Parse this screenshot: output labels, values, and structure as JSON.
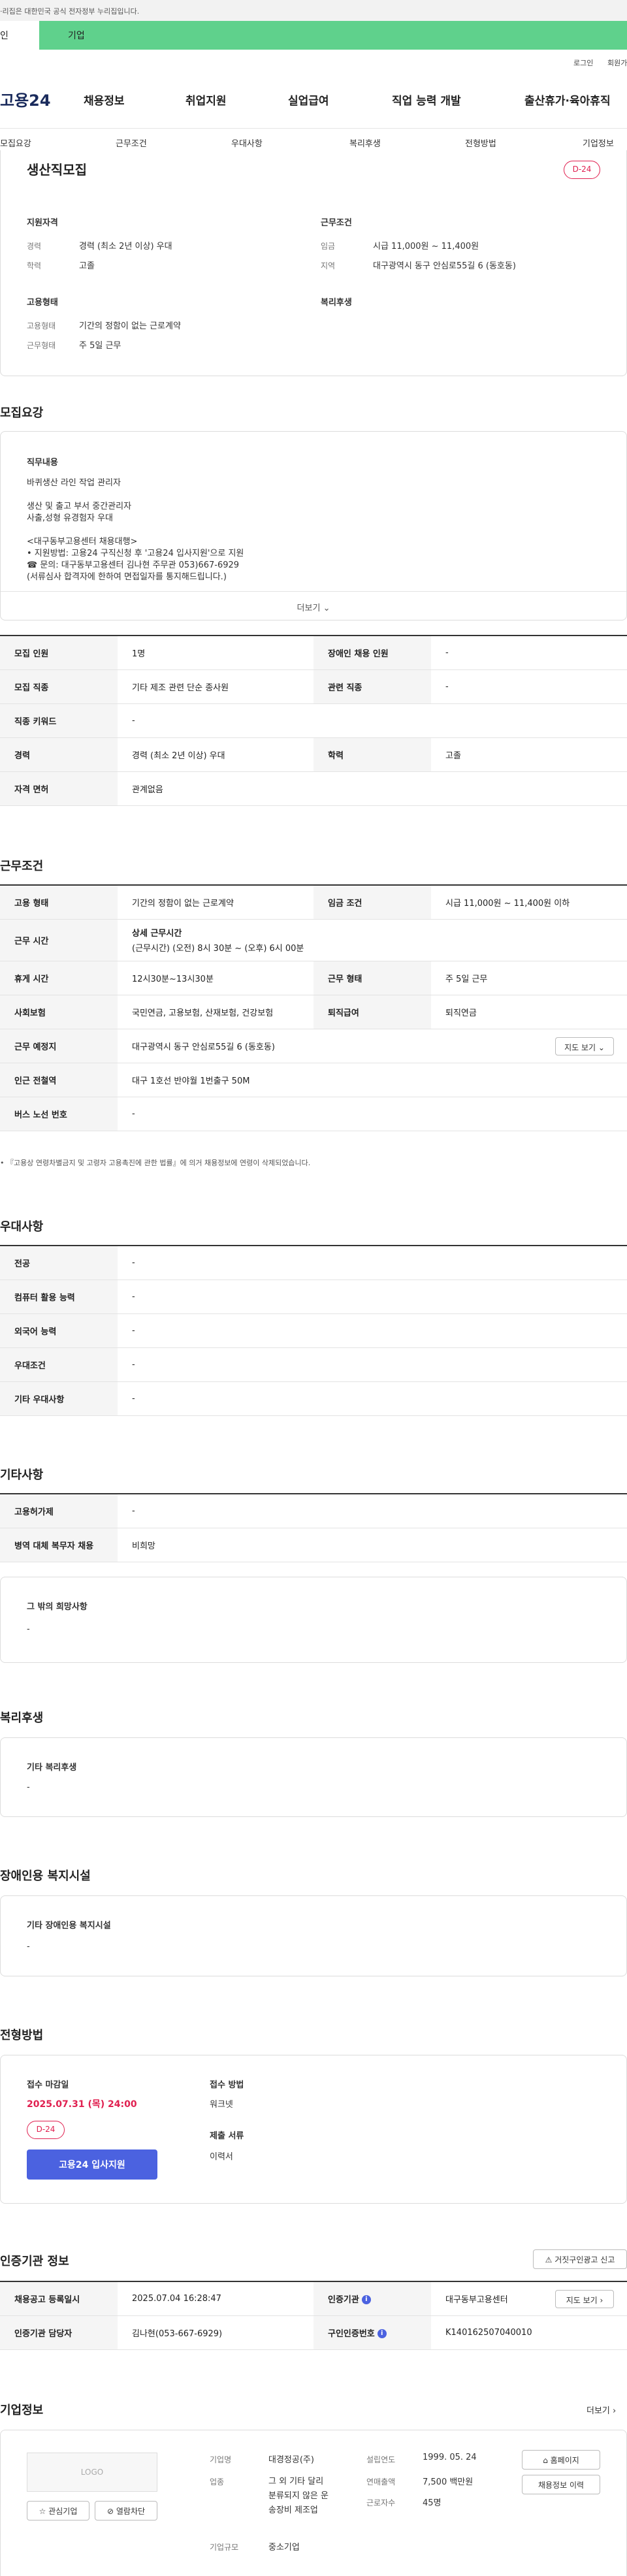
{
  "gov_banner": {
    "text": "·리집은 대한민국 공식 전자정부 누리집입니다."
  },
  "audience_tabs": {
    "individual": "인",
    "company": "기업"
  },
  "util": {
    "login": "로그인",
    "signup": "회원가"
  },
  "gnb": {
    "logo": "고용24",
    "menu": [
      "채용정보",
      "취업지원",
      "실업급여",
      "직업 능력 개발",
      "출산휴가·육아휴직"
    ]
  },
  "subnav": [
    "모집요강",
    "근무조건",
    "우대사항",
    "복리후생",
    "전형방법",
    "기업정보"
  ],
  "summary": {
    "title": "생산직모집",
    "dday": "D-24",
    "req_title": "지원자격",
    "career_label": "경력",
    "career_value": "경력 (최소 2년 이상) 우대",
    "edu_label": "학력",
    "edu_value": "고졸",
    "work_title": "근무조건",
    "wage_label": "임금",
    "wage_value": "시급 11,000원 ~ 11,400원",
    "region_label": "지역",
    "region_value": "대구광역시 동구 안심로55길 6 (동호동)",
    "emp_title": "고용형태",
    "emp_type_label": "고용형태",
    "emp_type_value": "기간의 정함이 없는 근로계약",
    "workdays_label": "근무형태",
    "workdays_value": "주 5일 근무",
    "welfare_title": "복리후생"
  },
  "recruit": {
    "section_title": "모집요강",
    "duty_title": "직무내용",
    "duty_lines": [
      "바퀴생산 라인 작업 관리자",
      "",
      "생산 및 출고  부서  중간관리자",
      "사출,성형 유경험자 우대",
      "",
      "<대구동부고용센터 채용대행>",
      "• 지원방법: 고용24 구직신청 후 '고용24 입사지원'으로 지원",
      "☎ 문의: 대구동부고용센터 김나현 주무관 053)667-6929",
      "(서류심사 합격자에 한하여 면접일자를 통지해드립니다.)"
    ],
    "more": "더보기",
    "rows": [
      {
        "l1": "모집 인원",
        "v1": "1명",
        "l2": "장애인 채용 인원",
        "v2": "-"
      },
      {
        "l1": "모집 직종",
        "v1": "기타 제조 관련 단순 종사원",
        "l2": "관련 직종",
        "v2": "-"
      },
      {
        "l1": "직종 키워드",
        "v1": "-"
      },
      {
        "l1": "경력",
        "v1": "경력 (최소 2년 이상) 우대",
        "l2": "학력",
        "v2": "고졸"
      },
      {
        "l1": "자격 면허",
        "v1": "관계없음"
      }
    ]
  },
  "work": {
    "section_title": "근무조건",
    "emp_type_l": "고용 형태",
    "emp_type_v": "기간의 정함이 없는 근로계약",
    "wage_l": "임금 조건",
    "wage_v": "시급 11,000원 ~ 11,400원 이하",
    "hours_l": "근무 시간",
    "hours_head": "상세 근무시간",
    "hours_v": "(근무시간) (오전) 8시 30분 ~ (오후) 6시 00분",
    "break_l": "휴게 시간",
    "break_v": "12시30분~13시30분",
    "shift_l": "근무 형태",
    "shift_v": "주 5일 근무",
    "insurance_l": "사회보험",
    "insurance_v": "국민연금, 고용보험, 산재보험, 건강보험",
    "retire_l": "퇴직급여",
    "retire_v": "퇴직연금",
    "place_l": "근무 예정지",
    "place_v": "대구광역시 동구 안심로55길 6 (동호동)",
    "map_btn": "지도 보기",
    "station_l": "인근 전철역",
    "station_v": "대구 1호선 반야월 1번출구 50M",
    "bus_l": "버스 노선 번호",
    "bus_v": "-",
    "note": "• 『고용상 연령차별금지 및 고령자 고용촉진에 관한 법률』에 의거 채용정보에 연령이 삭제되었습니다."
  },
  "pref": {
    "section_title": "우대사항",
    "rows": [
      {
        "l": "전공",
        "v": "-"
      },
      {
        "l": "컴퓨터 활용 능력",
        "v": "-"
      },
      {
        "l": "외국어 능력",
        "v": "-"
      },
      {
        "l": "우대조건",
        "v": "-"
      },
      {
        "l": "기타 우대사항",
        "v": "-"
      }
    ]
  },
  "etc": {
    "section_title": "기타사항",
    "rows": [
      {
        "l": "고용허가제",
        "v": "-"
      },
      {
        "l": "병역 대체 복무자 채용",
        "v": "비희망"
      }
    ],
    "hope_title": "그 밖의 희망사항",
    "hope_v": "-"
  },
  "welfare": {
    "section_title": "복리후생",
    "box_title": "기타 복리후생",
    "box_v": "-"
  },
  "disability": {
    "section_title": "장애인용 복지시설",
    "box_title": "기타 장애인용 복지시설",
    "box_v": "-"
  },
  "selection": {
    "section_title": "전형방법",
    "deadline_l": "접수 마감일",
    "deadline_v": "2025.07.31 (목) 24:00",
    "dday": "D-24",
    "apply_btn": "고용24 입사지원",
    "method_l": "접수 방법",
    "method_v": "워크넷",
    "docs_l": "제출 서류",
    "docs_v": "이력서"
  },
  "cert": {
    "section_title": "인증기관 정보",
    "report_btn": "거짓구인광고 신고",
    "reg_l": "채용공고 등록일시",
    "reg_v": "2025.07.04 16:28:47",
    "org_l": "인증기관",
    "org_v": "대구동부고용센터",
    "map_btn": "지도 보기",
    "mgr_l": "인증기관 담당자",
    "mgr_v": "김나현(053-667-6929)",
    "no_l": "구인인증번호",
    "no_v": "K140162507040010"
  },
  "company": {
    "section_title": "기업정보",
    "more": "더보기",
    "logo": "LOGO",
    "fav_btn": "관심기업",
    "block_btn": "열람차단",
    "name_l": "기업명",
    "name_v": "대경정공(주)",
    "ind_l": "업종",
    "ind_v": [
      "그 외 기타 달리",
      "분류되지 않은 운",
      "송장비 제조업"
    ],
    "size_l": "기업규모",
    "size_v": "중소기업",
    "est_l": "설립연도",
    "est_v": "1999. 05. 24",
    "sales_l": "연매출액",
    "sales_v": "7,500 백만원",
    "emp_l": "근로자수",
    "emp_v": "45명",
    "home_btn": "홈페이지",
    "history_btn": "채용정보 이력"
  }
}
